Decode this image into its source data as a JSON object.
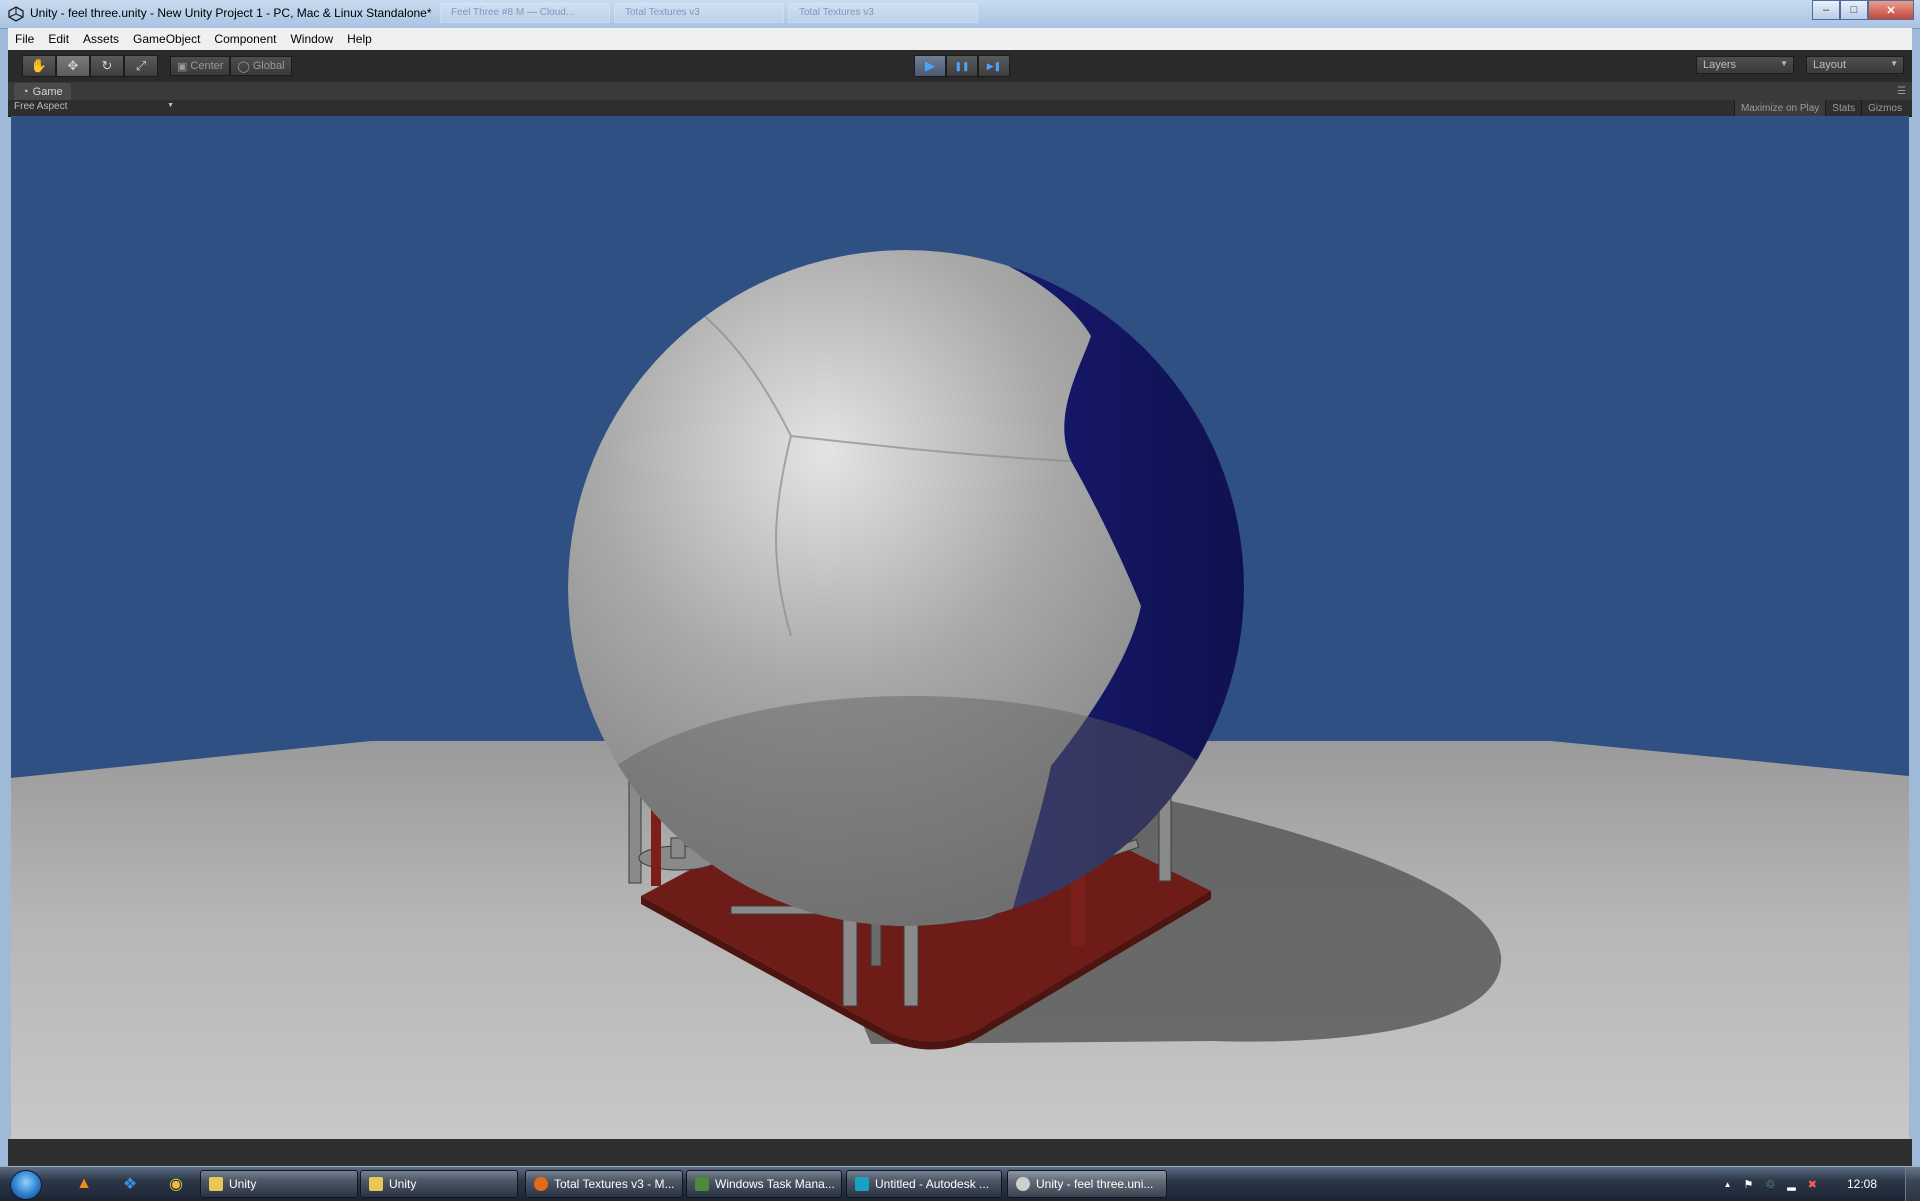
{
  "window": {
    "title": "Unity - feel three.unity - New Unity Project 1 - PC, Mac & Linux Standalone*",
    "background_tabs": [
      "Feel Three #8 M — Cloud...",
      "Total Textures v3",
      "Total Textures v3"
    ],
    "buttons": {
      "minimize": "–",
      "maximize": "□",
      "close": "✕"
    }
  },
  "menu": [
    "File",
    "Edit",
    "Assets",
    "GameObject",
    "Component",
    "Window",
    "Help"
  ],
  "toolbar": {
    "tools": [
      {
        "name": "hand-tool",
        "icon": "✋"
      },
      {
        "name": "move-tool",
        "icon": "✥"
      },
      {
        "name": "rotate-tool",
        "icon": "↻"
      },
      {
        "name": "scale-tool",
        "icon": "⤢"
      }
    ],
    "pivot": {
      "center_label": "Center",
      "global_label": "Global"
    },
    "playback": {
      "play": "▶",
      "pause": "❚❚",
      "step": "▶❚"
    },
    "layers_label": "Layers",
    "layout_label": "Layout"
  },
  "game_panel": {
    "tab_label": "Game",
    "aspect_label": "Free Aspect",
    "maximize_label": "Maximize on Play",
    "stats_label": "Stats",
    "gizmos_label": "Gizmos"
  },
  "colors": {
    "sky": "#2f5083",
    "ball_white": "#b9b9b9",
    "ball_blue": "#14166b",
    "base_red": "#6e1c18",
    "floor": "#bdbdbd"
  },
  "taskbar": {
    "pinned": [
      {
        "name": "vlc-icon",
        "glyph": "▲",
        "color": "#f28a1a"
      },
      {
        "name": "dropbox-icon",
        "glyph": "❖",
        "color": "#3d8fe6"
      },
      {
        "name": "chrome-icon",
        "glyph": "◉",
        "color": "#e2c13a"
      }
    ],
    "buttons": [
      {
        "label": "Unity",
        "icon_color": "#e8c85a"
      },
      {
        "label": "Unity",
        "icon_color": "#e8c85a"
      },
      {
        "label": "Total Textures v3 - M...",
        "icon_color": "#e26a1c"
      },
      {
        "label": "Windows Task Mana...",
        "icon_color": "#4a8a3a"
      },
      {
        "label": "Untitled - Autodesk ...",
        "icon_color": "#1aa0c4"
      },
      {
        "label": "Unity - feel three.uni...",
        "icon_color": "#cfcfcf"
      }
    ],
    "tray_icons": [
      "▲",
      "⚑",
      "♲",
      "▂",
      "✖"
    ],
    "clock": "12:08"
  }
}
